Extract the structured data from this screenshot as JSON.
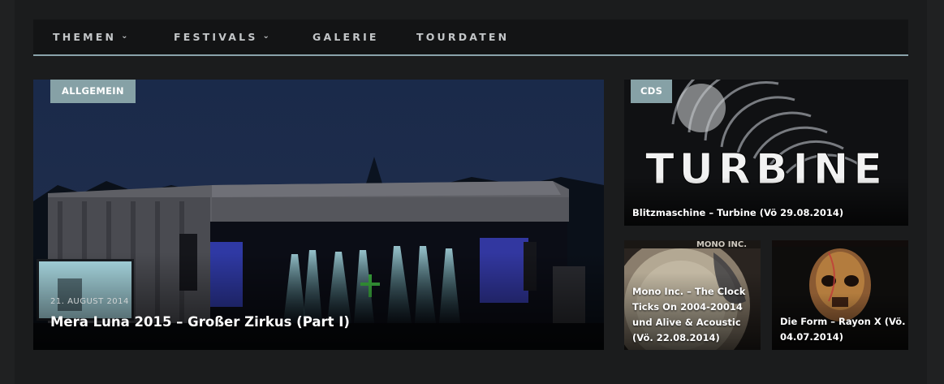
{
  "nav": {
    "items": [
      {
        "label": "THEMEN",
        "has_dropdown": true
      },
      {
        "label": "FESTIVALS",
        "has_dropdown": true
      },
      {
        "label": "GALERIE",
        "has_dropdown": false
      },
      {
        "label": "TOURDATEN",
        "has_dropdown": false
      }
    ],
    "chevron_icon": "chevron-down-icon"
  },
  "posts": {
    "main": {
      "category": "ALLGEMEIN",
      "date": "21. AUGUST 2014",
      "title": "Mera Luna 2015 – Großer Zirkus (Part I)"
    },
    "top_right": {
      "category": "CDS",
      "artwork_text": "TURBINE",
      "title": "Blitzmaschine – Turbine (Vö 29.08.2014)"
    },
    "bottom_left": {
      "artwork_text": "MONO INC.",
      "title": "Mono Inc. – The Clock Ticks On 2004-20014 und Alive & Acoustic (Vö. 22.08.2014)"
    },
    "bottom_right": {
      "title": "Die Form – Rayon X (Vö. 04.07.2014)"
    }
  },
  "colors": {
    "accent": "#86a1a6",
    "nav_bg": "#131415",
    "page_bg": "#202122"
  }
}
